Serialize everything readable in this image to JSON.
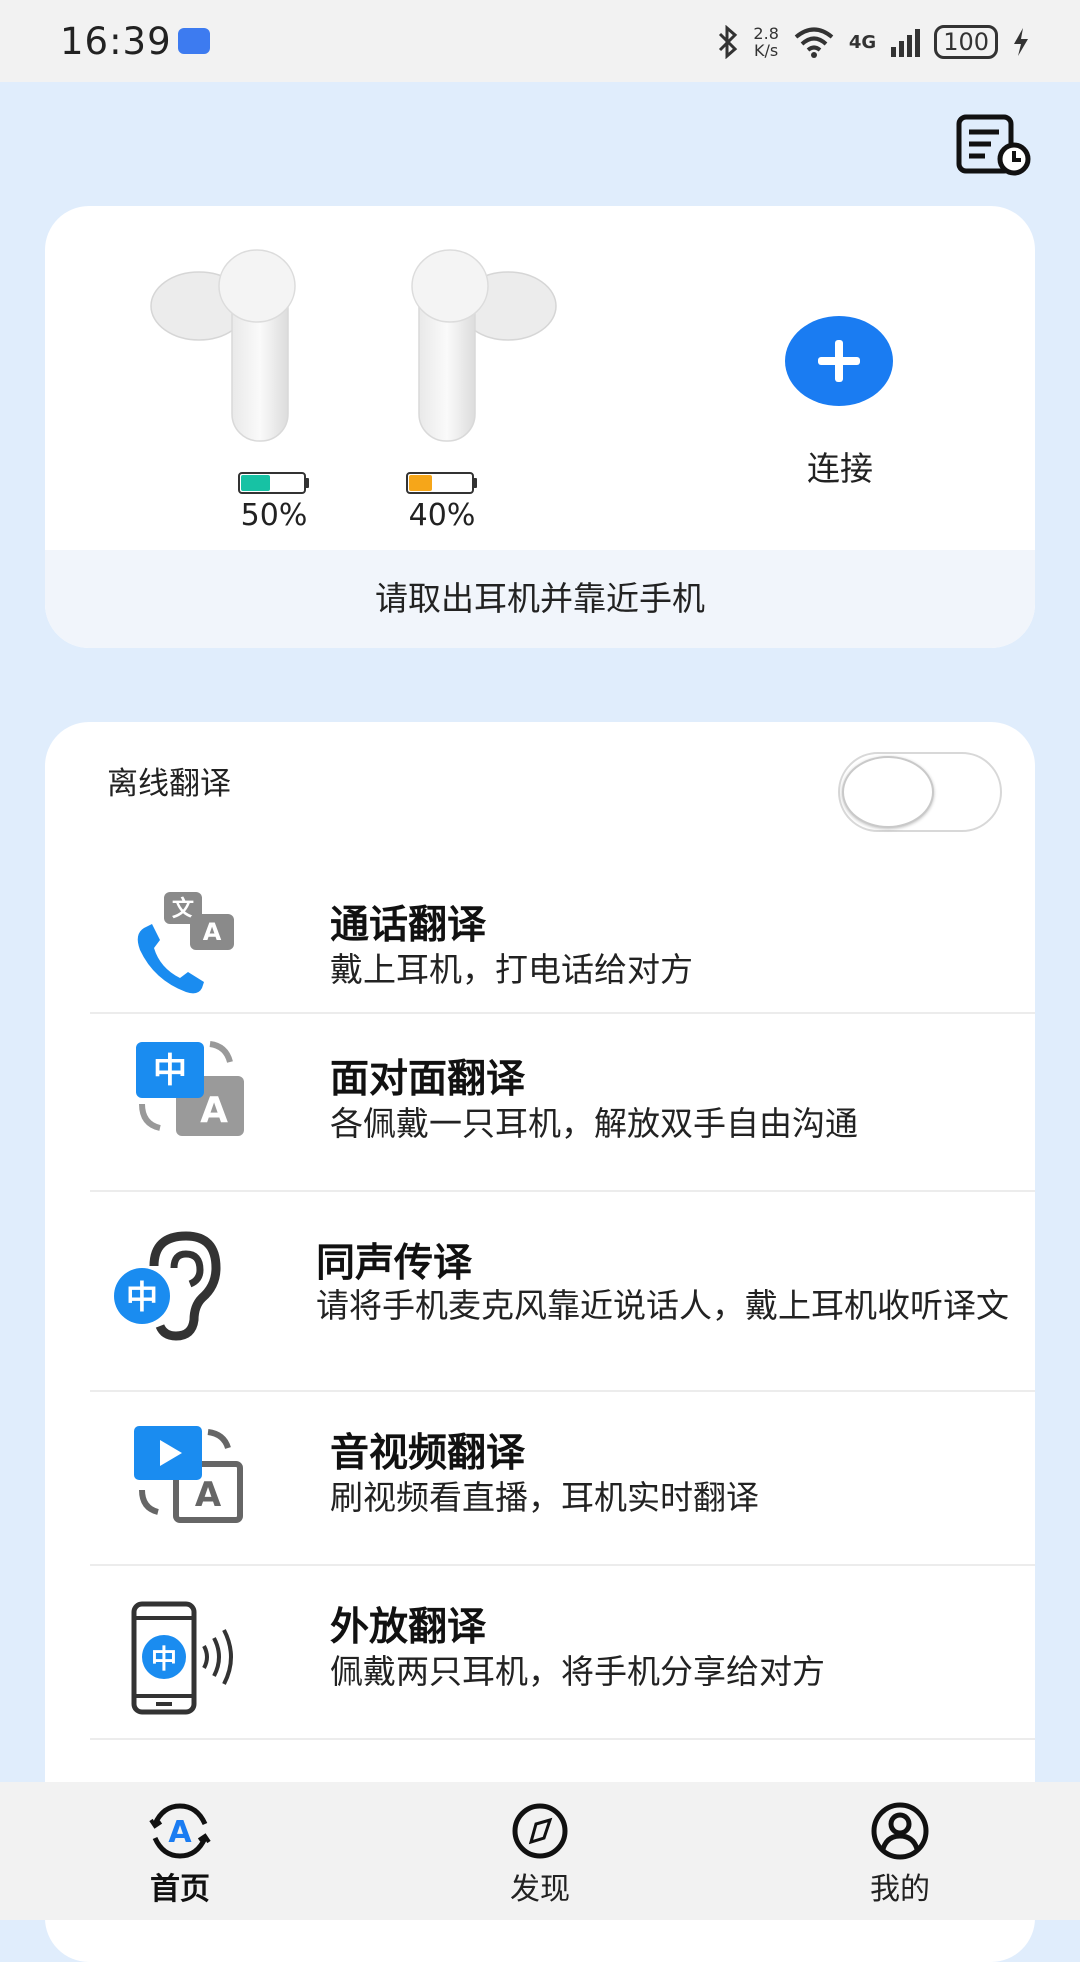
{
  "status_bar": {
    "time": "16:39",
    "net_speed_value": "2.8",
    "net_speed_unit": "K/s",
    "network_type": "4G",
    "battery": "100",
    "icons": [
      "usb-icon",
      "bluetooth-icon",
      "wifi-icon",
      "signal-icon",
      "battery-icon",
      "charging-icon"
    ]
  },
  "header": {
    "history_icon": "history-list-icon"
  },
  "device": {
    "left_battery_level": 0.5,
    "right_battery_level": 0.4,
    "left_battery_label": "50%",
    "right_battery_label": "40%",
    "left_battery_color": "#17c2a4",
    "right_battery_color": "#f6a619",
    "connect_label": "连接",
    "hint": "请取出耳机并靠近手机"
  },
  "offline": {
    "label": "离线翻译",
    "enabled": false
  },
  "features": [
    {
      "title": "通话翻译",
      "desc": "戴上耳机，打电话给对方",
      "icon": "call-translate-icon"
    },
    {
      "title": "面对面翻译",
      "desc": "各佩戴一只耳机，解放双手自由沟通",
      "icon": "face-to-face-translate-icon"
    },
    {
      "title": "同声传译",
      "desc": "请将手机麦克风靠近说话人，戴上耳机收听译文",
      "icon": "simultaneous-interpretation-icon"
    },
    {
      "title": "音视频翻译",
      "desc": "刷视频看直播，耳机实时翻译",
      "icon": "audio-video-translate-icon"
    },
    {
      "title": "外放翻译",
      "desc": "佩戴两只耳机，将手机分享给对方",
      "icon": "speaker-translate-icon"
    }
  ],
  "nav": [
    {
      "label": "首页",
      "icon": "home-translate-icon",
      "active": true
    },
    {
      "label": "发现",
      "icon": "compass-icon",
      "active": false
    },
    {
      "label": "我的",
      "icon": "profile-icon",
      "active": false
    }
  ],
  "colors": {
    "accent": "#1a7cf2",
    "background": "#e0edfc"
  }
}
